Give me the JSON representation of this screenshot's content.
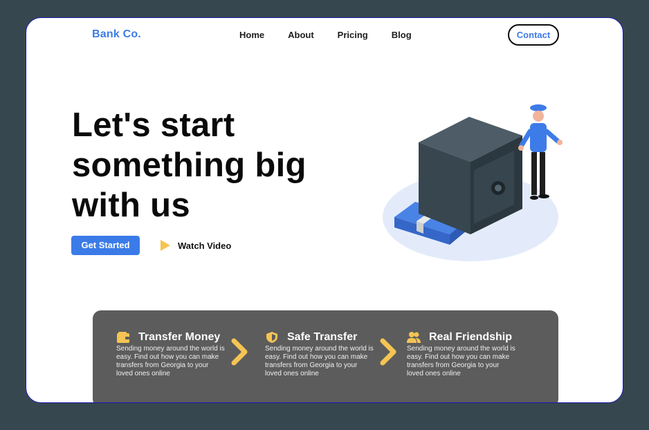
{
  "brand": "Bank Co.",
  "nav": {
    "items": [
      "Home",
      "About",
      "Pricing",
      "Blog"
    ],
    "contact_label": "Contact"
  },
  "hero": {
    "title_lines": [
      "Let's start",
      "something big",
      "with us"
    ],
    "primary_cta": "Get Started",
    "secondary_cta": "Watch Video"
  },
  "features": [
    {
      "icon": "wallet-icon",
      "title": "Transfer Money",
      "desc": "Sending money around the world is easy. Find out how you can make transfers from Georgia to your loved ones online"
    },
    {
      "icon": "shield-icon",
      "title": "Safe Transfer",
      "desc": "Sending money around the world is easy. Find out how you can make transfers from Georgia to your loved ones online"
    },
    {
      "icon": "users-icon",
      "title": "Real Friendship",
      "desc": "Sending money around the world is easy. Find out how you can make transfers from Georgia to your loved ones online"
    }
  ],
  "colors": {
    "background": "#37474f",
    "accent": "#3b7be8",
    "feature_panel": "#5c5c5c",
    "highlight": "#f5c453"
  }
}
